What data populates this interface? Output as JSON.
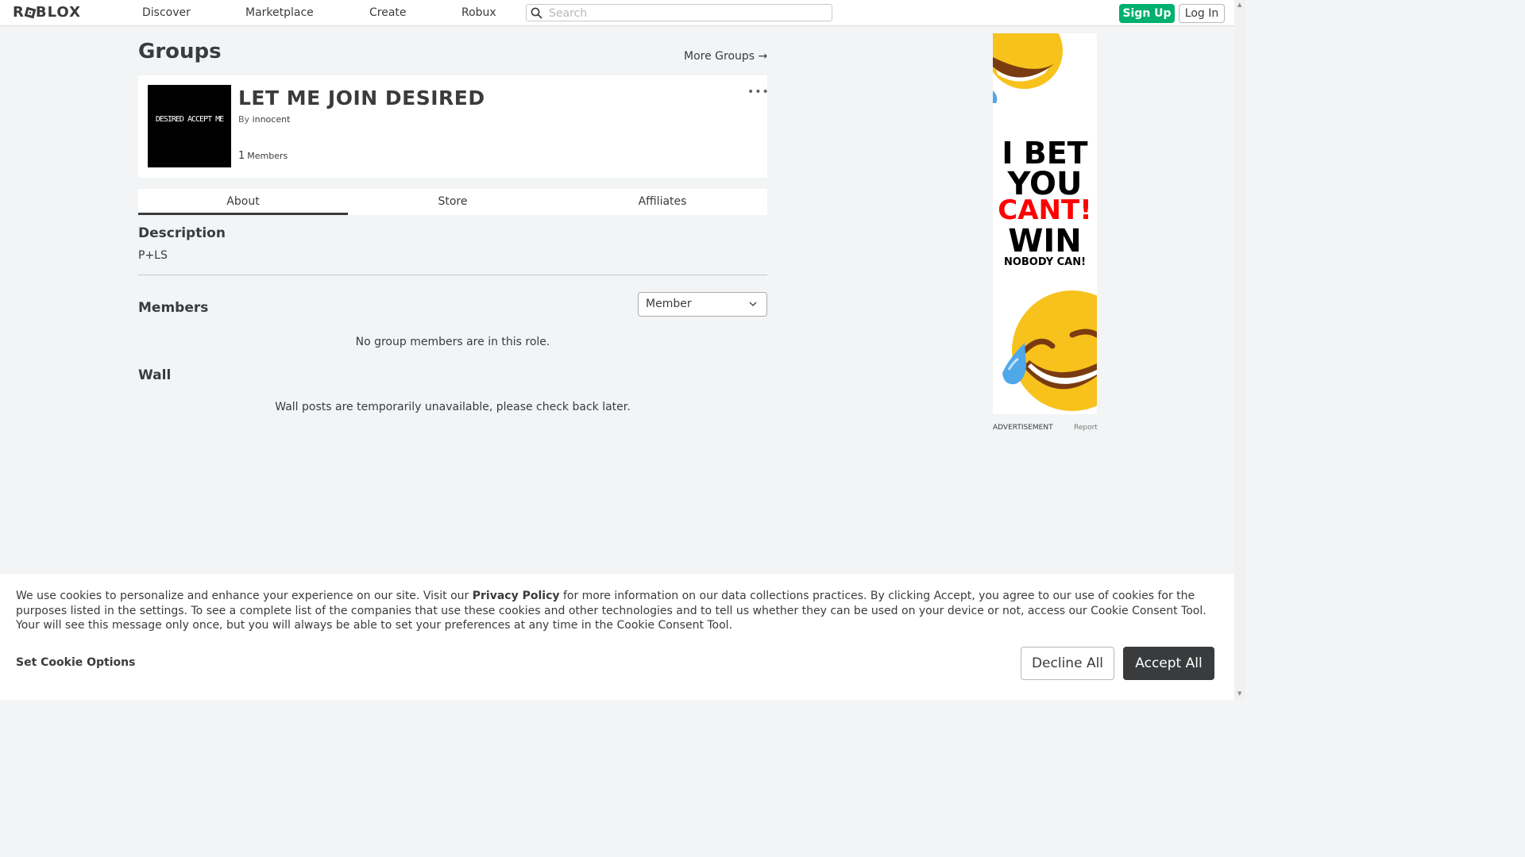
{
  "nav": {
    "logo": "ROBLOX",
    "links": [
      "Discover",
      "Marketplace",
      "Create",
      "Robux"
    ],
    "search_placeholder": "Search",
    "signup": "Sign Up",
    "login": "Log In"
  },
  "page": {
    "title": "Groups",
    "more_groups": "More Groups →"
  },
  "group": {
    "emblem_text": "DESIRED ACCEPT ME",
    "name": "LET ME JOIN DESIRED",
    "by_label": "By",
    "owner": "innocent",
    "member_count": "1",
    "members_label": "Members",
    "more_icon": "•••"
  },
  "tabs": [
    "About",
    "Store",
    "Affiliates"
  ],
  "about": {
    "description_title": "Description",
    "description": "P+LS",
    "members_title": "Members",
    "role_selected": "Member",
    "members_empty": "No group members are in this role.",
    "wall_title": "Wall",
    "wall_empty": "Wall posts are temporarily unavailable, please check back later."
  },
  "ad": {
    "line1": "I BET",
    "line2": "YOU",
    "line3": "CANT!",
    "line4": "WIN",
    "line5": "NOBODY CAN!",
    "label": "ADVERTISEMENT",
    "report": "Report"
  },
  "cookie": {
    "text_before": "We use cookies to personalize and enhance your experience on our site. Visit our ",
    "privacy_link": "Privacy Policy",
    "text_after": " for more information on our data collections practices. By clicking Accept, you agree to our use of cookies for the purposes listed in the settings. To see a complete list of the companies that use these cookies and other technologies and to tell us whether they can be used on your device or not, access our Cookie Consent Tool. Your will see this message only once, but you will always be able to set your preferences at any time in the Cookie Consent Tool.",
    "options": "Set Cookie Options",
    "decline": "Decline All",
    "accept": "Accept All"
  },
  "colors": {
    "signup_green": "#00b06f",
    "background": "#f2f4f5",
    "text": "#393b3d",
    "ad_red": "#ff0000"
  }
}
